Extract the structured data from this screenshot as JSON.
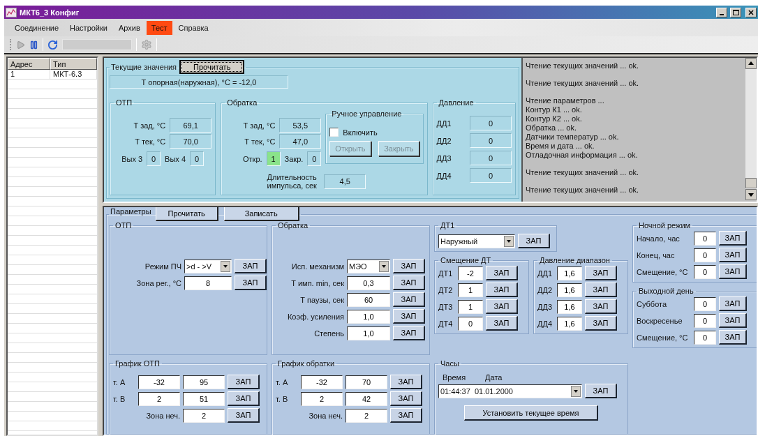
{
  "window": {
    "title": "МКТ6_3 Конфиг"
  },
  "menu": [
    {
      "label": "Соединение",
      "selected": false
    },
    {
      "label": "Настройки",
      "selected": false
    },
    {
      "label": "Архив",
      "selected": false
    },
    {
      "label": "Тест",
      "selected": true
    },
    {
      "label": "Справка",
      "selected": false
    }
  ],
  "toolbar": {
    "progress": {
      "level": 0
    }
  },
  "device_list": {
    "columns": [
      "Адрес",
      "Тип"
    ],
    "rows": [
      [
        "1",
        "МКТ-6.3"
      ]
    ]
  },
  "current": {
    "title": "Текущие значения",
    "read_button": "Прочитать",
    "reference": "Т опорная(наружная), °C = -12,0",
    "otp": {
      "title": "ОТП",
      "fields": [
        {
          "label": "Т зад, °C",
          "value": "69,1"
        },
        {
          "label": "Т тек, °C",
          "value": "70,0"
        }
      ],
      "outputs": [
        {
          "label": "Вых 3",
          "value": "0",
          "active": false
        },
        {
          "label": "Вых 4",
          "value": "0",
          "active": false
        }
      ]
    },
    "return": {
      "title": "Обратка",
      "fields": [
        {
          "label": "Т зад, °C",
          "value": "53,5"
        },
        {
          "label": "Т тек, °C",
          "value": "47,0"
        }
      ],
      "outputs": [
        {
          "label": "Откр.",
          "value": "1",
          "active": true
        },
        {
          "label": "Закр.",
          "value": "0",
          "active": false
        }
      ],
      "pulse": {
        "label": "Длительность импульса, сек",
        "value": "4,5"
      }
    },
    "manual": {
      "title": "Ручное управление",
      "enable": {
        "label": "Включить",
        "checked": false
      },
      "buttons": [
        {
          "label": "Открыть",
          "disabled": true
        },
        {
          "label": "Закрыть",
          "disabled": true
        }
      ]
    },
    "pressure": {
      "title": "Давление",
      "fields": [
        {
          "label": "ДД1",
          "value": "0"
        },
        {
          "label": "ДД2",
          "value": "0"
        },
        {
          "label": "ДД3",
          "value": "0"
        },
        {
          "label": "ДД4",
          "value": "0"
        }
      ]
    }
  },
  "log": [
    [
      "Чтение текущих значений ... ok."
    ],
    [
      "Чтение текущих значений ... ok."
    ],
    [
      "Чтение параметров ...",
      "Контур К1 ... ok.",
      "Контур К2 ... ok.",
      "Обратка ... ok.",
      "Датчики температур ... ok.",
      "Время и дата ... ok.",
      "Отладочная информация ... ok."
    ],
    [
      "Чтение текущих значений ... ok."
    ],
    [
      "Чтение текущих значений ... ok."
    ]
  ],
  "parameters": {
    "title": "Параметры",
    "buttons": [
      "Прочитать",
      "Записать"
    ],
    "otp": {
      "title": "ОТП",
      "rows": [
        {
          "label": "Режим ПЧ",
          "kind": "select",
          "value": ">d - >V",
          "button": "ЗАП"
        },
        {
          "label": "Зона рег., °C",
          "kind": "input",
          "value": "8",
          "button": "ЗАП"
        }
      ]
    },
    "return": {
      "title": "Обратка",
      "rows": [
        {
          "label": "Исп. механизм",
          "kind": "select",
          "value": "МЭО",
          "button": "ЗАП"
        },
        {
          "label": "Т имп. min, сек",
          "kind": "input",
          "value": "0,3",
          "button": "ЗАП"
        },
        {
          "label": "Т паузы, сек",
          "kind": "input",
          "value": "60",
          "button": "ЗАП"
        },
        {
          "label": "Коэф. усиления",
          "kind": "input",
          "value": "1,0",
          "button": "ЗАП"
        },
        {
          "label": "Степень",
          "kind": "input",
          "value": "1,0",
          "button": "ЗАП"
        }
      ]
    },
    "dt1": {
      "title": "ДТ1",
      "value": "Наружный",
      "button": "ЗАП"
    },
    "dt_offset": {
      "title": "Смещение ДТ",
      "rows": [
        {
          "label": "ДТ1",
          "kind": "input",
          "value": "-2",
          "button": "ЗАП"
        },
        {
          "label": "ДТ2",
          "kind": "input",
          "value": "1",
          "button": "ЗАП"
        },
        {
          "label": "ДТ3",
          "kind": "input",
          "value": "1",
          "button": "ЗАП"
        },
        {
          "label": "ДТ4",
          "kind": "input",
          "value": "0",
          "button": "ЗАП"
        }
      ]
    },
    "pressure_range": {
      "title": "Давление диапазон",
      "rows": [
        {
          "label": "ДД1",
          "kind": "input",
          "value": "1,6",
          "button": "ЗАП"
        },
        {
          "label": "ДД2",
          "kind": "input",
          "value": "1,6",
          "button": "ЗАП"
        },
        {
          "label": "ДД3",
          "kind": "input",
          "value": "1,6",
          "button": "ЗАП"
        },
        {
          "label": "ДД4",
          "kind": "input",
          "value": "1,6",
          "button": "ЗАП"
        }
      ]
    },
    "night": {
      "title": "Ночной режим",
      "rows": [
        {
          "label": "Начало, час",
          "kind": "input",
          "value": "0",
          "button": "ЗАП"
        },
        {
          "label": "Конец, час",
          "kind": "input",
          "value": "0",
          "button": "ЗАП"
        },
        {
          "label": "Смещение, °C",
          "kind": "input",
          "value": "0",
          "button": "ЗАП"
        }
      ]
    },
    "weekend": {
      "title": "Выходной день",
      "rows": [
        {
          "label": "Суббота",
          "kind": "input",
          "value": "0",
          "button": "ЗАП"
        },
        {
          "label": "Воскресенье",
          "kind": "input",
          "value": "0",
          "button": "ЗАП"
        },
        {
          "label": "Смещение, °C",
          "kind": "input",
          "value": "0",
          "button": "ЗАП"
        }
      ]
    },
    "otp_chart": {
      "title": "График ОТП",
      "rows": [
        {
          "label": "т. А",
          "values": [
            "-32",
            "95"
          ],
          "button": "ЗАП"
        },
        {
          "label": "т. В",
          "values": [
            "2",
            "51"
          ],
          "button": "ЗАП"
        },
        {
          "label": "Зона неч.",
          "values": [
            "2"
          ],
          "button": "ЗАП"
        }
      ]
    },
    "return_chart": {
      "title": "График обратки",
      "rows": [
        {
          "label": "т. А",
          "values": [
            "-32",
            "70"
          ],
          "button": "ЗАП"
        },
        {
          "label": "т. В",
          "values": [
            "2",
            "42"
          ],
          "button": "ЗАП"
        },
        {
          "label": "Зона неч.",
          "values": [
            "2"
          ],
          "button": "ЗАП"
        }
      ]
    },
    "clock": {
      "title": "Часы",
      "time_label": "Время",
      "date_label": "Дата",
      "value": "01:44:37  01.01.2000",
      "button": "ЗАП",
      "set_button": "Установить текущее время"
    }
  }
}
